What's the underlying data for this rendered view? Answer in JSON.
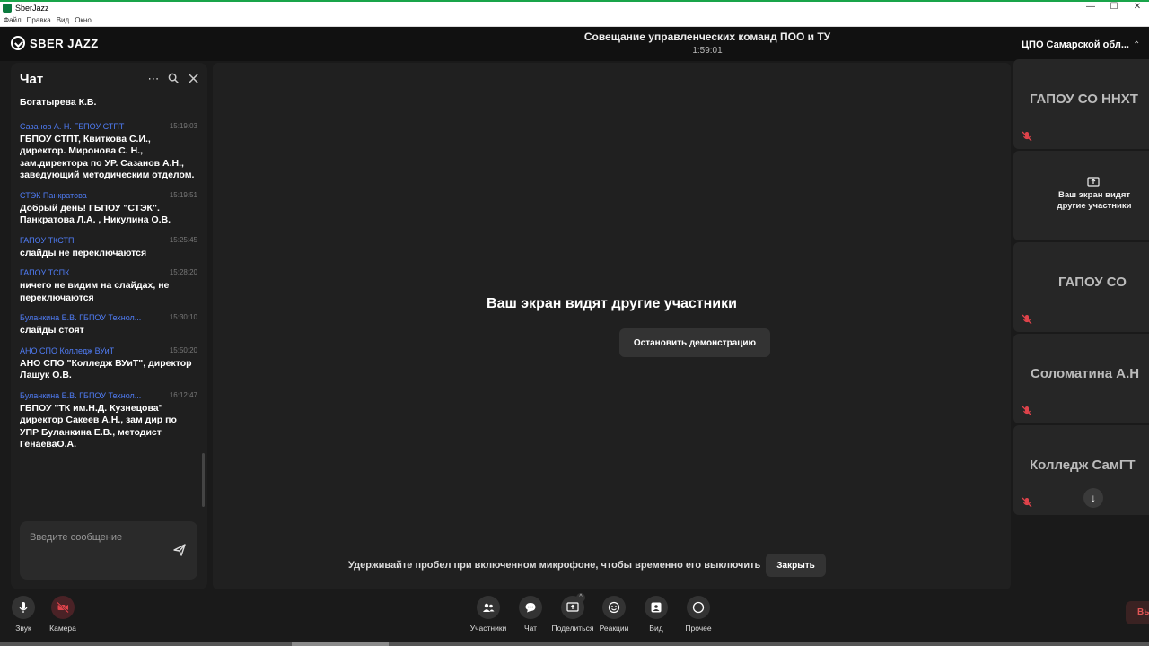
{
  "window": {
    "title": "SberJazz",
    "menu": [
      "Файл",
      "Правка",
      "Вид",
      "Окно"
    ]
  },
  "app": {
    "logo_text": "SBER JAZZ",
    "meeting_title": "Совещание управленческих команд ПОО и ТУ",
    "meeting_time": "1:59:01"
  },
  "chat": {
    "title": "Чат",
    "icons": [
      "more-icon",
      "search-icon",
      "close-icon"
    ],
    "first_text": "Богатырева К.В.",
    "messages": [
      {
        "author": "Сазанов А. Н. ГБПОУ СТПТ",
        "time": "15:19:03",
        "text": "ГБПОУ СТПТ, Квиткова С.И., директор. Миронова С. Н., зам.директора по УР. Сазанов А.Н., заведующий методическим отделом."
      },
      {
        "author": "СТЭК Панкратова",
        "time": "15:19:51",
        "text": "Добрый день! ГБПОУ \"СТЭК\". Панкратова Л.А. , Никулина О.В."
      },
      {
        "author": "ГАПОУ ТКСТП",
        "time": "15:25:45",
        "text": "слайды не переключаются"
      },
      {
        "author": "ГАПОУ ТСПК",
        "time": "15:28:20",
        "text": "ничего не видим на слайдах, не переключаются"
      },
      {
        "author": "Буланкина Е.В. ГБПОУ Технол...",
        "time": "15:30:10",
        "text": "слайды стоят"
      },
      {
        "author": "АНО СПО Колледж ВУиТ",
        "time": "15:50:20",
        "text": "АНО СПО \"Колледж ВУиТ\", директор Лашук О.В."
      },
      {
        "author": "Буланкина Е.В. ГБПОУ Технол...",
        "time": "16:12:47",
        "text": "ГБПОУ \"ТК им.Н.Д. Кузнецова\" директор Сакеев А.Н., зам дир по УПР Буланкина Е.В., методист ГенаеваО.А."
      }
    ],
    "input_placeholder": "Введите сообщение"
  },
  "stage": {
    "share_message": "Ваш экран видят другие участники",
    "stop_button": "Остановить демонстрацию",
    "hint": "Удерживайте пробел при включенном микрофоне, чтобы временно его выключить",
    "close_button": "Закрыть"
  },
  "participants": {
    "title": "ЦПО Самарской обл...",
    "tiles": [
      {
        "name": "ГАПОУ СО ННХТ",
        "muted": true
      },
      {
        "screen_text_1": "Ваш экран видят",
        "screen_text_2": "другие участники"
      },
      {
        "name": "ГАПОУ СО",
        "muted": true
      },
      {
        "name": "Соломатина А.Н",
        "muted": true
      },
      {
        "name": "Колледж СамГТ",
        "muted": true
      }
    ]
  },
  "toolbar": {
    "sound": "Звук",
    "camera": "Камера",
    "participants": "Участники",
    "chat": "Чат",
    "share": "Поделиться",
    "reactions": "Реакции",
    "view": "Вид",
    "more": "Прочее",
    "exit": "Вы"
  },
  "colors": {
    "accent_blue": "#4f7cf5",
    "muted_red": "#e0434b",
    "camera_off": "#e0434b"
  }
}
